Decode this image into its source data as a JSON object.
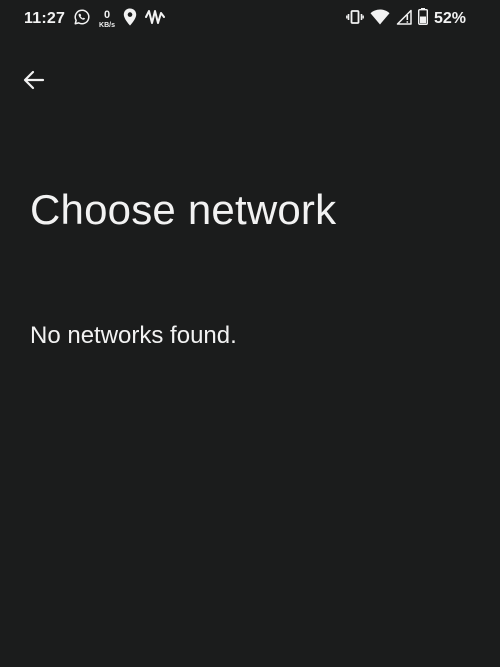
{
  "status_bar": {
    "time": "11:27",
    "net_speed_value": "0",
    "net_speed_unit": "KB/s",
    "battery_percent": "52%",
    "left_icons": [
      "whatsapp-icon",
      "kbs-speed-indicator",
      "location-pin-icon",
      "activity-wave-icon"
    ],
    "right_icons": [
      "vibrate-icon",
      "wifi-icon",
      "cell-signal-icon",
      "battery-icon"
    ]
  },
  "header": {
    "back_icon": "arrow-back-icon"
  },
  "main": {
    "title": "Choose network",
    "empty_message": "No networks found."
  },
  "colors": {
    "background": "#1b1c1c",
    "foreground": "#f2f2f2"
  }
}
